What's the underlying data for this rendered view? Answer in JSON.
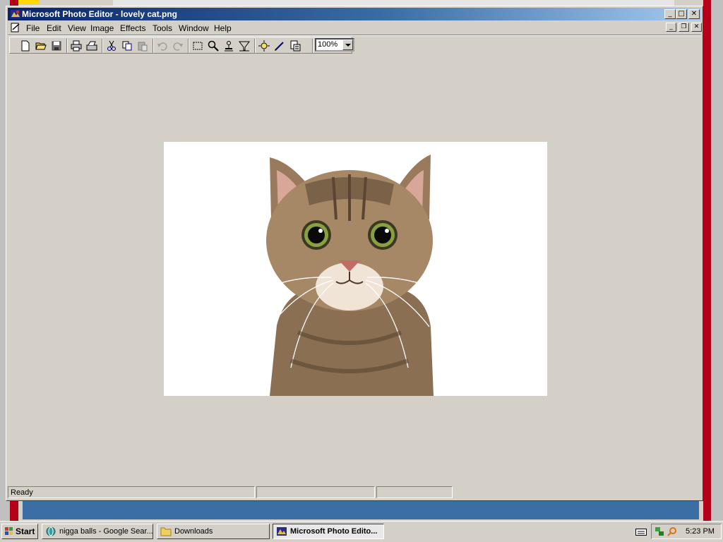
{
  "window": {
    "title": "Microsoft Photo Editor - lovely cat.png",
    "caption_minimize": "_",
    "caption_maximize": "□",
    "caption_close": "✕"
  },
  "menubar": {
    "items": [
      "File",
      "Edit",
      "View",
      "Image",
      "Effects",
      "Tools",
      "Window",
      "Help"
    ]
  },
  "toolbar": {
    "zoom_value": "100%"
  },
  "statusbar": {
    "status_text": "Ready"
  },
  "taskbar": {
    "start_label": "Start",
    "tasks": [
      {
        "label": "nigga balls - Google Sear..."
      },
      {
        "label": "Downloads"
      },
      {
        "label": "Microsoft Photo Edito..."
      }
    ],
    "clock": "5:23 PM"
  },
  "colors": {
    "title_gradient_start": "#0a246a",
    "title_gradient_end": "#a6caf0",
    "face": "#d4d0c8",
    "background_window_red": "#b5001a",
    "background_window_blue": "#3a6ea5"
  }
}
